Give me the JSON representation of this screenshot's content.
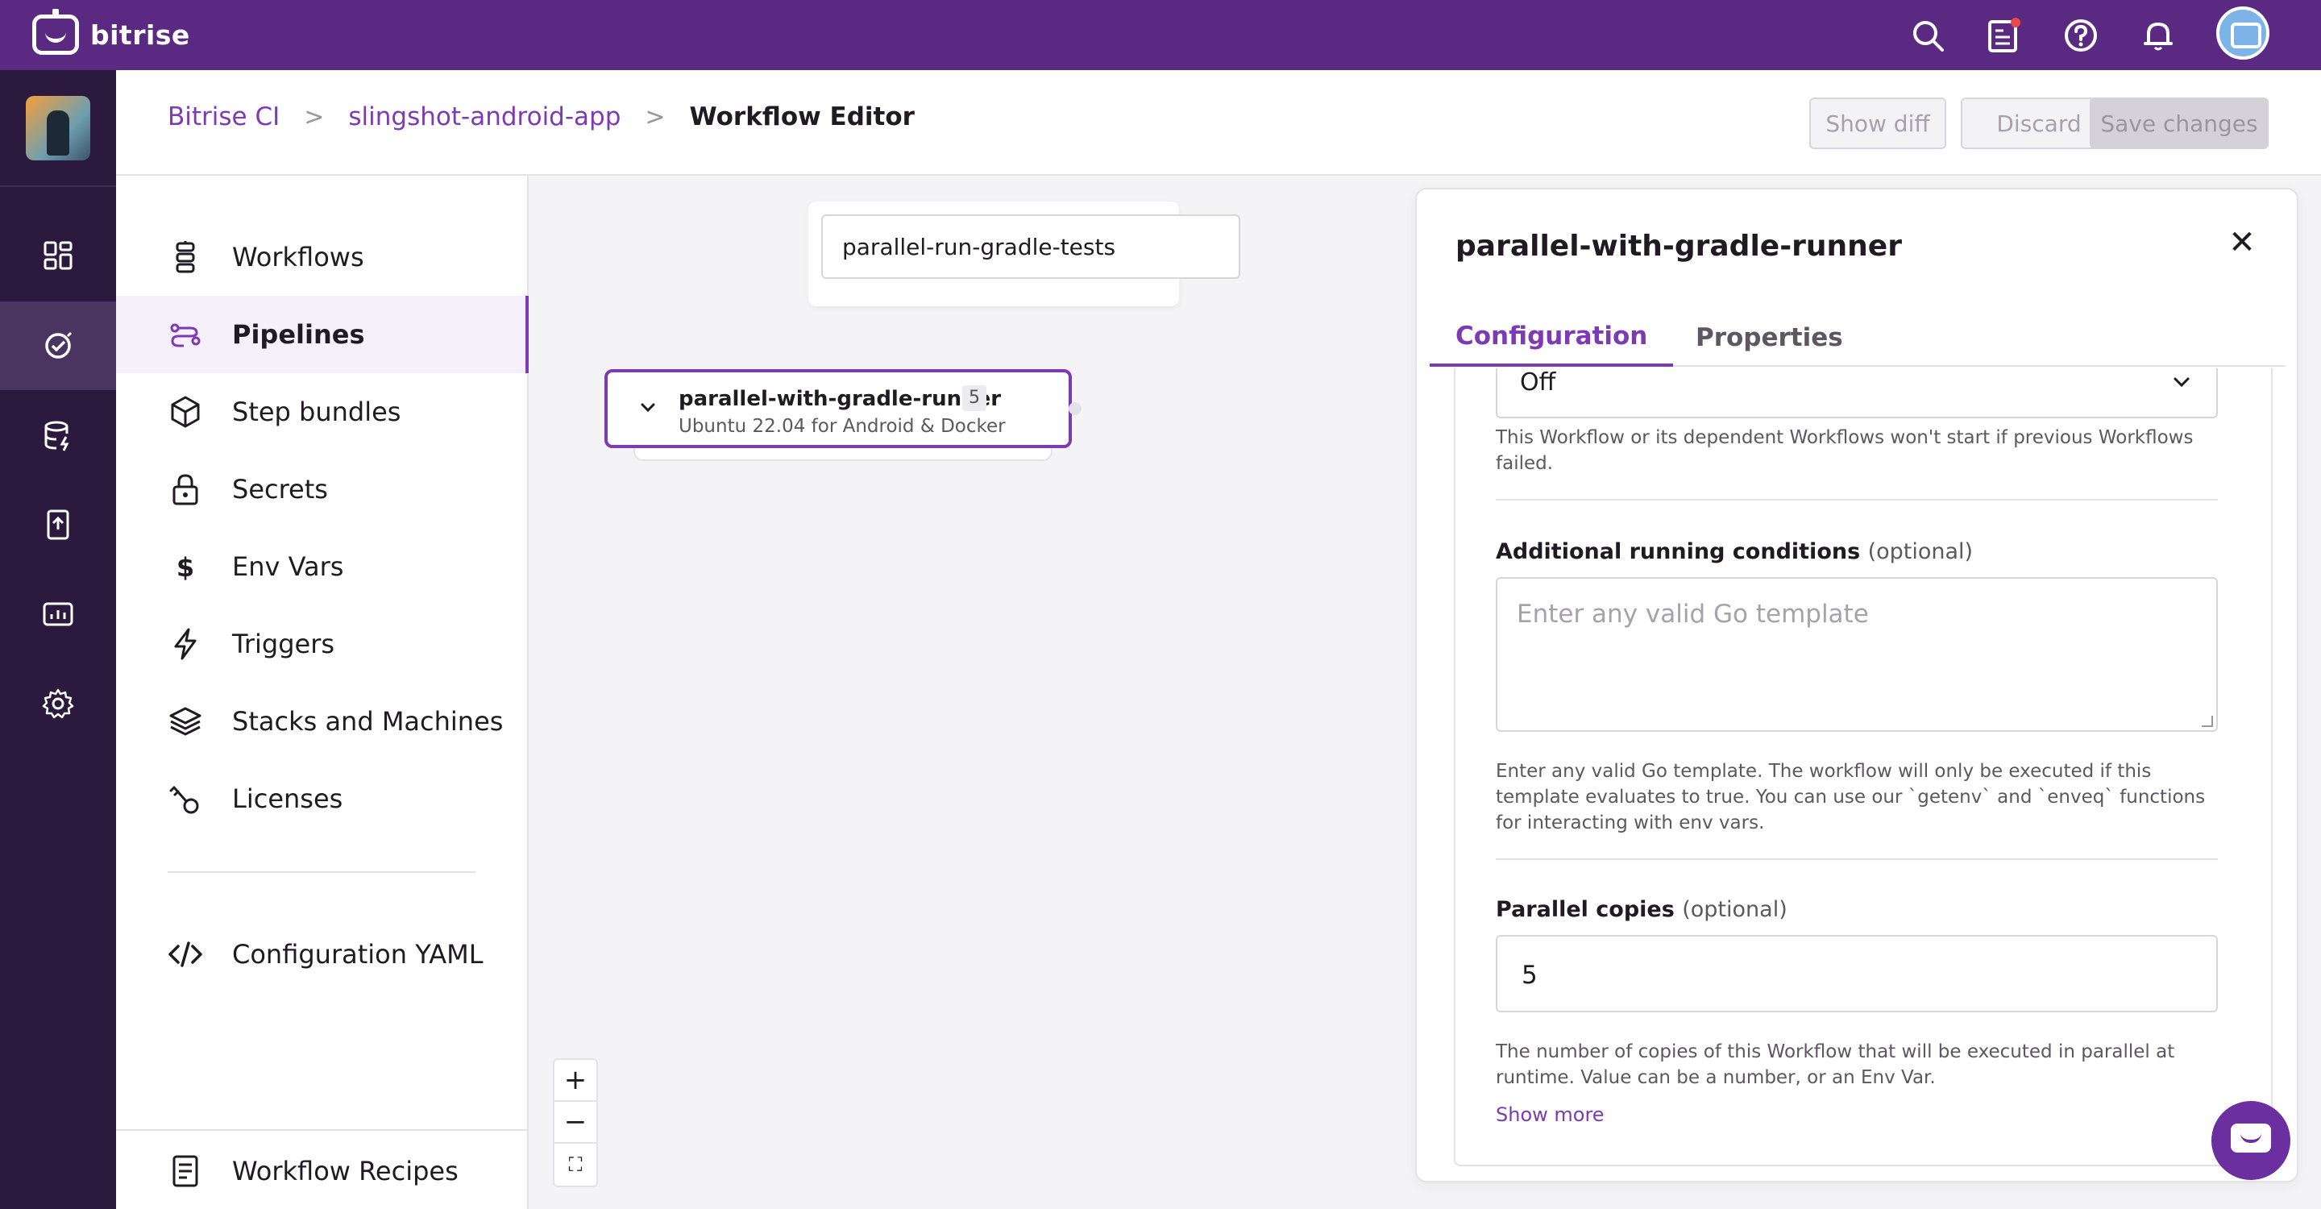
{
  "app": {
    "brand": "bitrise"
  },
  "topbar": {
    "icons": [
      "search-icon",
      "build-report-icon",
      "help-icon",
      "bell-icon",
      "profile-avatar"
    ]
  },
  "rail": {
    "items": [
      "dashboard-icon",
      "ci-icon",
      "build-cache-icon",
      "release-icon",
      "insights-icon",
      "settings-icon"
    ],
    "active": "ci-icon"
  },
  "breadcrumb": {
    "items": [
      "Bitrise CI",
      "slingshot-android-app"
    ],
    "current": "Workflow Editor"
  },
  "header_buttons": {
    "show_diff": "Show diff",
    "discard": "Discard",
    "save": "Save changes"
  },
  "sidebar": {
    "items": [
      {
        "label": "Workflows",
        "icon": "workflows-icon"
      },
      {
        "label": "Pipelines",
        "icon": "pipelines-icon",
        "active": true
      },
      {
        "label": "Step bundles",
        "icon": "cube-icon"
      },
      {
        "label": "Secrets",
        "icon": "lock-icon"
      },
      {
        "label": "Env Vars",
        "icon": "dollar-icon"
      },
      {
        "label": "Triggers",
        "icon": "lightning-icon"
      },
      {
        "label": "Stacks and Machines",
        "icon": "layers-icon"
      },
      {
        "label": "Licenses",
        "icon": "key-icon"
      }
    ],
    "config_yaml": "Configuration YAML",
    "recipes": "Workflow Recipes"
  },
  "canvas": {
    "pipeline_select": "parallel-run-gradle-tests",
    "workflow_card": {
      "name": "parallel-with-gradle-runner",
      "badge": "5",
      "stack": "Ubuntu 22.04 for Android & Docker"
    },
    "zoom": {
      "in": "+",
      "out": "−",
      "fit": "⛶"
    }
  },
  "panel": {
    "title": "parallel-with-gradle-runner",
    "close": "✕",
    "tabs": [
      "Configuration",
      "Properties"
    ],
    "active_tab": "Configuration",
    "run_if_select": "Off",
    "run_if_help": "This Workflow or its dependent Workflows won't start if previous Workflows failed.",
    "conditions_label": "Additional running conditions",
    "conditions_optional": "(optional)",
    "conditions_placeholder": "Enter any valid Go template",
    "conditions_help": "Enter any valid Go template. The workflow will only be executed if this template evaluates to true. You can use our `getenv` and `enveq` functions for interacting with env vars.",
    "parallel_label": "Parallel copies",
    "parallel_optional": "(optional)",
    "parallel_value": "5",
    "parallel_help": "The number of copies of this Workflow that will be executed in parallel at runtime. Value can be a number, or an Env Var.",
    "show_more": "Show more"
  },
  "colors": {
    "brand_purple": "#5a2a82",
    "accent": "#7d3ab4",
    "rail_bg": "#2b1a3d"
  }
}
